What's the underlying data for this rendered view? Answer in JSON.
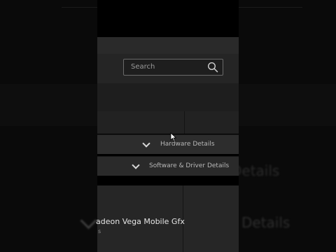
{
  "search": {
    "placeholder": "Search"
  },
  "accordion": {
    "hardware_label": "Hardware Details",
    "software_label": "Software & Driver Details"
  },
  "device": {
    "name": "adeon Vega Mobile Gfx",
    "sub": "s"
  },
  "background": {
    "ghost_text_1": "Details",
    "ghost_text_2": "Details"
  },
  "colors": {
    "panel_bg": "#262626",
    "page_bg": "#0a0a0a"
  }
}
